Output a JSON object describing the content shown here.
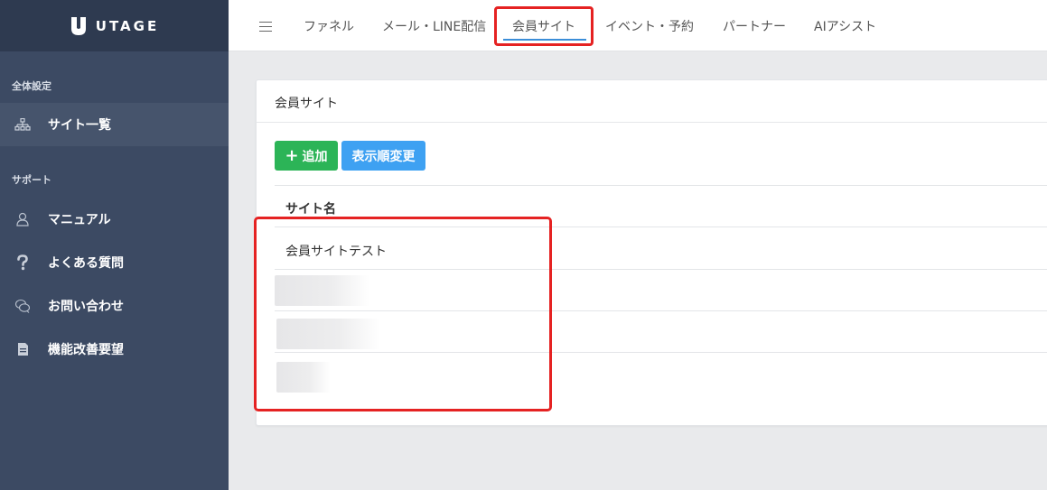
{
  "brand": {
    "name": "UTAGE"
  },
  "sidebar": {
    "section1_label": "全体設定",
    "section2_label": "サポート",
    "items": [
      {
        "label": "サイト一覧",
        "icon": "sitemap-icon"
      },
      {
        "label": "マニュアル",
        "icon": "user-icon"
      },
      {
        "label": "よくある質問",
        "icon": "question-icon"
      },
      {
        "label": "お問い合わせ",
        "icon": "chat-icon"
      },
      {
        "label": "機能改善要望",
        "icon": "document-icon"
      }
    ]
  },
  "topnav": {
    "tabs": [
      {
        "label": "ファネル"
      },
      {
        "label": "メール・LINE配信"
      },
      {
        "label": "会員サイト"
      },
      {
        "label": "イベント・予約"
      },
      {
        "label": "パートナー"
      },
      {
        "label": "AIアシスト"
      }
    ],
    "active_tab": "会員サイト"
  },
  "main": {
    "card_title": "会員サイト",
    "add_button": "追加",
    "add_icon": "+",
    "order_button": "表示順変更",
    "table_header": "サイト名",
    "rows": [
      {
        "name": "会員サイトテスト"
      }
    ]
  },
  "colors": {
    "sidebar_bg": "#3c4a63",
    "logo_bg": "#2e3a50",
    "highlight": "#e52222",
    "add_button": "#2cb457",
    "order_button": "#3ea1f2",
    "tab_underline": "#3b8ed8"
  }
}
